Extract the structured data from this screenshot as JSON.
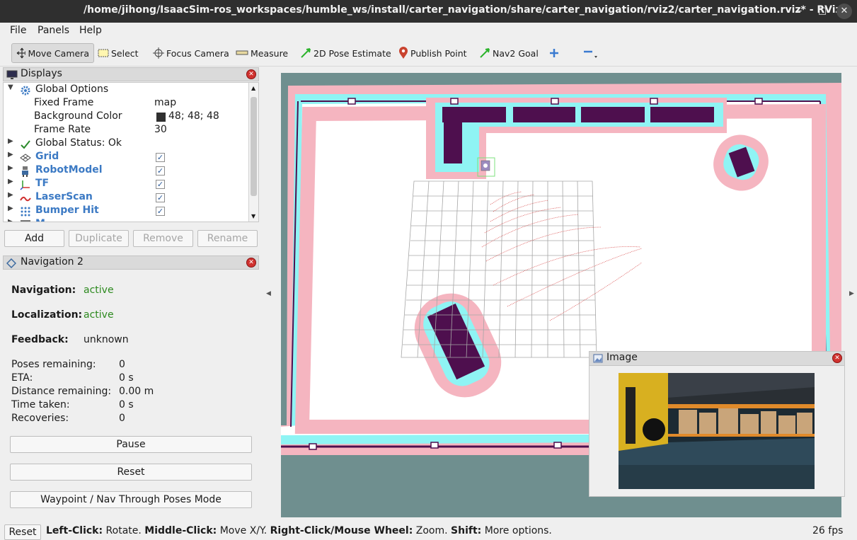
{
  "window": {
    "title": "/home/jihong/IsaacSim-ros_workspaces/humble_ws/install/carter_navigation/share/carter_navigation/rviz2/carter_navigation.rviz* - RViz",
    "controls": {
      "minimize": "–",
      "maximize": "□",
      "close": "✕"
    }
  },
  "menu": {
    "file": "File",
    "panels": "Panels",
    "help": "Help"
  },
  "toolbar": {
    "move_camera": "Move Camera",
    "select": "Select",
    "focus_camera": "Focus Camera",
    "measure": "Measure",
    "pose_estimate": "2D Pose Estimate",
    "publish_point": "Publish Point",
    "nav2_goal": "Nav2 Goal"
  },
  "displays": {
    "title": "Displays",
    "global_options": "Global Options",
    "fixed_frame_label": "Fixed Frame",
    "fixed_frame_value": "map",
    "bg_color_label": "Background Color",
    "bg_color_value": "48; 48; 48",
    "frame_rate_label": "Frame Rate",
    "frame_rate_value": "30",
    "global_status": "Global Status: Ok",
    "items": [
      {
        "label": "Grid",
        "icon": "grid-icon",
        "checked": true
      },
      {
        "label": "RobotModel",
        "icon": "robot-icon",
        "checked": true
      },
      {
        "label": "TF",
        "icon": "tf-axes-icon",
        "checked": true
      },
      {
        "label": "LaserScan",
        "icon": "laserscan-icon",
        "checked": true
      },
      {
        "label": "Bumper Hit",
        "icon": "bumper-hit-icon",
        "checked": true
      }
    ],
    "partial_next": "M",
    "buttons": {
      "add": "Add",
      "duplicate": "Duplicate",
      "remove": "Remove",
      "rename": "Rename"
    }
  },
  "navigation": {
    "title": "Navigation 2",
    "navigation_label": "Navigation:",
    "navigation_value": "active",
    "localization_label": "Localization:",
    "localization_value": "active",
    "feedback_label": "Feedback:",
    "feedback_value": "unknown",
    "poses_label": "Poses remaining:",
    "poses_value": "0",
    "eta_label": "ETA:",
    "eta_value": "0 s",
    "distance_label": "Distance remaining:",
    "distance_value": "0.00 m",
    "time_label": "Time taken:",
    "time_value": "0 s",
    "recoveries_label": "Recoveries:",
    "recoveries_value": "0",
    "pause": "Pause",
    "reset": "Reset",
    "waypoint_mode": "Waypoint / Nav Through Poses Mode"
  },
  "image_panel": {
    "title": "Image"
  },
  "status": {
    "reset": "Reset",
    "left_click": "Left-Click:",
    "left_click_desc": " Rotate. ",
    "middle_click": "Middle-Click:",
    "middle_click_desc": " Move X/Y. ",
    "right_click": "Right-Click/Mouse Wheel:",
    "right_click_desc": " Zoom. ",
    "shift": "Shift:",
    "shift_desc": " More options.",
    "fps": "26 fps"
  },
  "colors": {
    "map_free": "#ffffff",
    "map_unknown": "#6f8f8f",
    "costmap_inflation": "#f5b5c0",
    "costmap_inscribed": "#8ff4f4",
    "obstacle": "#4e0f4e",
    "laser": "#d84848",
    "grid": "#a0a0a0"
  }
}
